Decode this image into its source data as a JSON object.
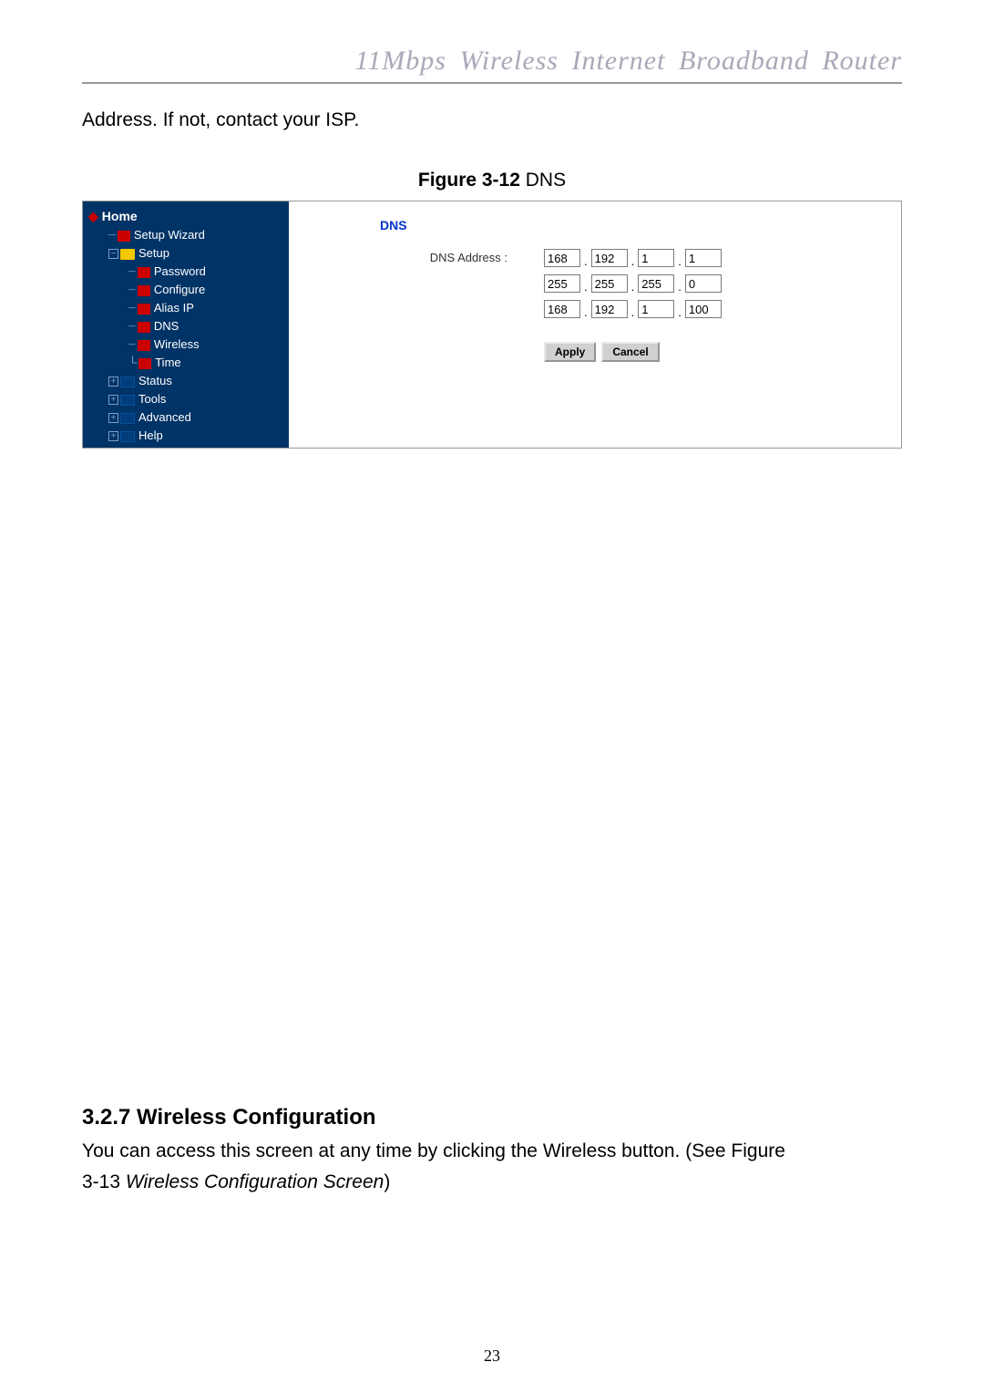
{
  "header": "11Mbps  Wireless  Internet  Broadband  Router",
  "intro": "Address. If not, contact your ISP.",
  "figure_caption_bold": "Figure 3-12",
  "figure_caption_rest": " DNS",
  "nav": {
    "home": "Home",
    "items": [
      {
        "label": "Setup Wizard",
        "indent": 1,
        "icon": "doc"
      },
      {
        "label": "Setup",
        "indent": 1,
        "icon": "folder-open",
        "expand": "−"
      },
      {
        "label": "Password",
        "indent": 2,
        "icon": "doc"
      },
      {
        "label": "Configure",
        "indent": 2,
        "icon": "doc"
      },
      {
        "label": "Alias IP",
        "indent": 2,
        "icon": "doc"
      },
      {
        "label": "DNS",
        "indent": 2,
        "icon": "doc"
      },
      {
        "label": "Wireless",
        "indent": 2,
        "icon": "doc"
      },
      {
        "label": "Time",
        "indent": 2,
        "icon": "doc"
      },
      {
        "label": "Status",
        "indent": 1,
        "icon": "folder-closed",
        "expand": "+"
      },
      {
        "label": "Tools",
        "indent": 1,
        "icon": "folder-closed",
        "expand": "+"
      },
      {
        "label": "Advanced",
        "indent": 1,
        "icon": "folder-closed",
        "expand": "+"
      },
      {
        "label": "Help",
        "indent": 1,
        "icon": "folder-closed",
        "expand": "+"
      }
    ]
  },
  "content": {
    "title": "DNS",
    "field_label": "DNS Address :",
    "ip": {
      "r1": {
        "a": "168",
        "b": "192",
        "c": "1",
        "d": "1"
      },
      "r2": {
        "a": "255",
        "b": "255",
        "c": "255",
        "d": "0"
      },
      "r3": {
        "a": "168",
        "b": "192",
        "c": "1",
        "d": "100"
      }
    },
    "apply": "Apply",
    "cancel": "Cancel"
  },
  "section": {
    "heading": "3.2.7 Wireless Configuration",
    "body1": "You can access this screen at any time by clicking the Wireless button. (See Figure",
    "body2": "3-13 ",
    "body2_it": "Wireless Configuration Screen",
    "body3": ")"
  },
  "page_number": "23"
}
